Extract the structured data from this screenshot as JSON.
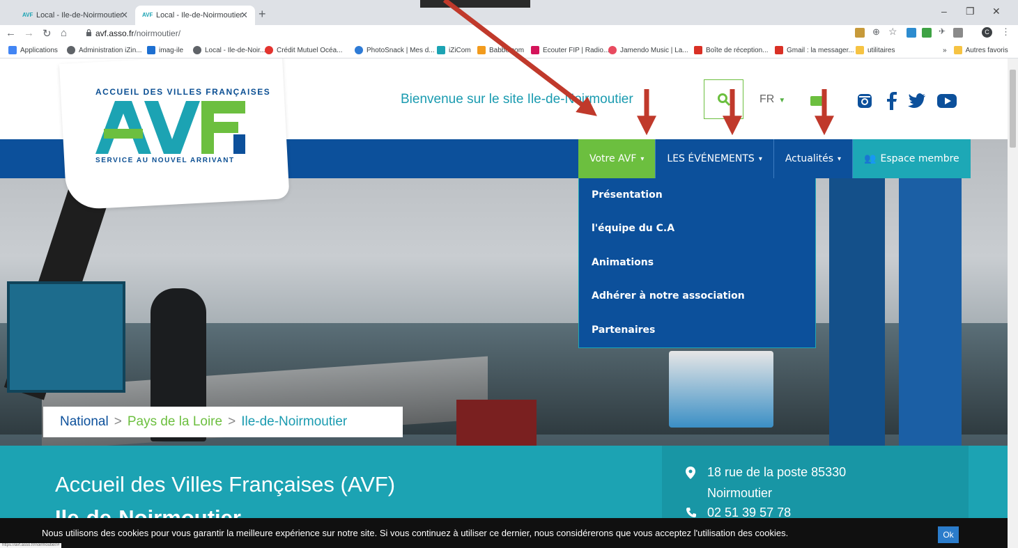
{
  "browser": {
    "tabs": [
      {
        "label": "Local - Ile-de-Noirmoutier",
        "active": false
      },
      {
        "label": "Local - Ile-de-Noirmoutier",
        "active": true
      }
    ],
    "url_host": "avf.asso.fr",
    "url_path": "/noirmoutier/",
    "bookmarks": [
      "Applications",
      "Administration iZin...",
      "imag-ile",
      "Local - Ile-de-Noir...",
      "Crédit Mutuel Océa...",
      "PhotoSnack | Mes d...",
      "iZiCom",
      "Babbelcom",
      "Ecouter FIP | Radio...",
      "Jamendo Music | La...",
      "Boîte de réception...",
      "Gmail : la messager...",
      "utilitaires",
      "Autres favoris"
    ],
    "status_url": "https://avf.asso.fr/noirmoutier/#"
  },
  "logo": {
    "top_text": "ACCUEIL DES VILLES FRANÇAISES",
    "bottom_text": "SERVICE AU NOUVEL ARRIVANT"
  },
  "header": {
    "welcome": "Bienvenue sur le site Ile-de-Noirmoutier",
    "lang": "FR"
  },
  "menu": {
    "items": [
      {
        "label": "Votre AVF"
      },
      {
        "label": "LES ÉVÉNEMENTS"
      },
      {
        "label": "Actualités"
      },
      {
        "label": "Espace membre"
      }
    ],
    "dropdown": [
      "Présentation",
      "l'équipe du C.A",
      "Animations",
      "Adhérer à notre association",
      "Partenaires"
    ]
  },
  "breadcrumb": {
    "national": "National",
    "region": "Pays de la Loire",
    "local": "Ile-de-Noirmoutier"
  },
  "intro": {
    "title": "Accueil des Villes Françaises (AVF)",
    "subtitle": "Ile-de-Noirmoutier",
    "address_line1": "18 rue de la poste 85330",
    "address_line2": "Noirmoutier",
    "phone": "02 51 39 57 78"
  },
  "cookie": {
    "text": "Nous utilisons des cookies pour vous garantir la meilleure expérience sur notre site. Si vous continuez à utiliser ce dernier, nous considérerons que vous acceptez l'utilisation des cookies.",
    "ok": "Ok"
  },
  "colors": {
    "blue": "#0c509b",
    "green": "#6cbf3f",
    "teal": "#1ca3b3",
    "annotation_red": "#c0392b"
  }
}
